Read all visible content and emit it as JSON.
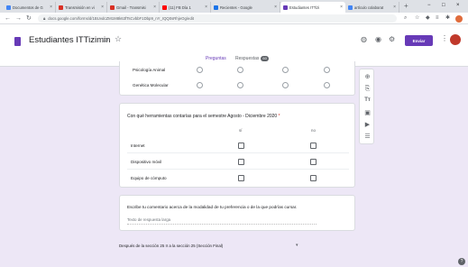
{
  "browser": {
    "tabs": [
      {
        "title": "Documentos de G",
        "color": "#4285f4"
      },
      {
        "title": "Transmisión en vi",
        "color": "#d93025"
      },
      {
        "title": "Gmail - Transmisi",
        "color": "#d93025"
      },
      {
        "title": "(11) FB Día 1",
        "color": "#ff0000"
      },
      {
        "title": "Recientes - Google",
        "color": "#1a73e8"
      },
      {
        "title": "Estudiantes ITTizi",
        "color": "#673ab7"
      },
      {
        "title": "artículo colaborat",
        "color": "#4285f4"
      }
    ],
    "new_tab": "+",
    "url": "docs.google.com/forms/d/1BUvdcZM1M8k63fTsCvbbF1Dbp9_nY_IQQ0sRhjeOg/edit",
    "window_controls": [
      "−",
      "□",
      "×"
    ]
  },
  "header": {
    "title": "Estudiantes ITTizimin",
    "send_label": "Enviar",
    "tabs": {
      "questions": "Preguntas",
      "responses": "Respuestas",
      "responses_count": "60"
    }
  },
  "card1": {
    "rows": [
      "Psicología Animal",
      "Genética Molecular"
    ]
  },
  "card2": {
    "question": "Con qué herramientas contarías para el semestre Agosto - Diciembre 2020",
    "required_mark": "*",
    "columns": [
      "sí",
      "no"
    ],
    "rows": [
      "Internet",
      "Dispositivo móvil",
      "Equipo de cómputo"
    ]
  },
  "card3": {
    "question": "Escribe tu comentario acerca de la modalidad de tu preferencia o de la que podrías cursar.",
    "placeholder": "Texto de respuesta larga"
  },
  "section_nav": {
    "text": "Después de la sección 25   Ir a la sección 25 (Sección Final)"
  },
  "sidebar_icons": [
    "add-question-icon",
    "import-questions-icon",
    "add-title-icon",
    "add-image-icon",
    "add-video-icon",
    "add-section-icon"
  ],
  "colors": {
    "accent": "#673ab7",
    "background": "#ede7f6"
  }
}
